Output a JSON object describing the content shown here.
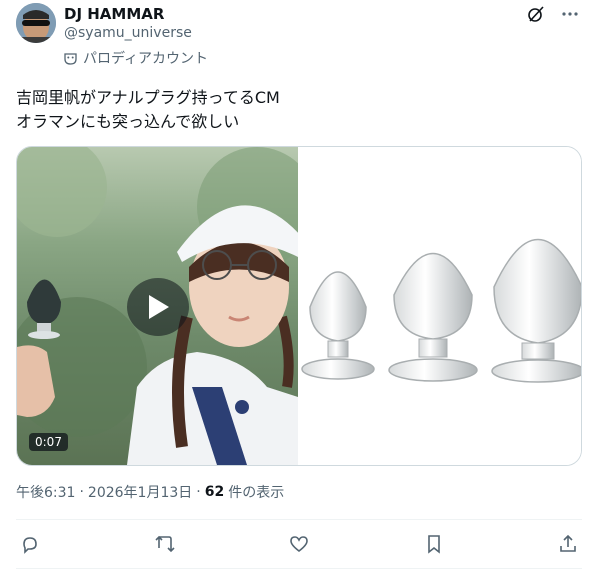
{
  "author": {
    "display_name": "DJ HAMMAR",
    "handle": "@syamu_universe",
    "label": "パロディアカウント"
  },
  "tweet": {
    "lines": [
      "吉岡里帆がアナルプラグ持ってるCM",
      "オラマンにも突っ込んで欲しい"
    ]
  },
  "media": {
    "duration": "0:07"
  },
  "meta": {
    "time": "午後6:31",
    "sep1": "·",
    "date": "2026年1月13日",
    "sep2": "·",
    "views_count": "62",
    "views_label": "件の表示"
  },
  "icons": {
    "grok": "grok-icon",
    "more": "more-icon",
    "reply": "reply-icon",
    "repost": "repost-icon",
    "like": "like-icon",
    "bookmark": "bookmark-icon",
    "share": "share-icon"
  },
  "colors": {
    "text": "#0f1419",
    "secondary": "#536471",
    "border": "#cfd9de"
  }
}
